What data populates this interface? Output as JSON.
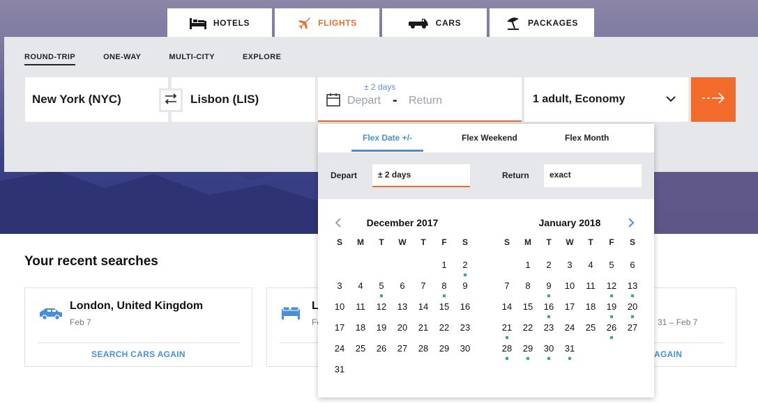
{
  "tabs": [
    {
      "label": "HOTELS",
      "icon": "bed-icon",
      "active": false
    },
    {
      "label": "FLIGHTS",
      "icon": "plane-icon",
      "active": true
    },
    {
      "label": "CARS",
      "icon": "car-icon",
      "active": false
    },
    {
      "label": "PACKAGES",
      "icon": "beach-umbrella-icon",
      "active": false
    }
  ],
  "trip_types": [
    "ROUND-TRIP",
    "ONE-WAY",
    "MULTI-CITY",
    "EXPLORE"
  ],
  "search": {
    "origin": "New York (NYC)",
    "destination": "Lisbon (LIS)",
    "flex_hint": "± 2 days",
    "depart_placeholder": "Depart",
    "date_separator": "-",
    "return_placeholder": "Return",
    "travelers": "1 adult, Economy"
  },
  "flex_popup": {
    "tabs": [
      "Flex Date +/-",
      "Flex Weekend",
      "Flex Month"
    ],
    "depart_label": "Depart",
    "depart_value": "± 2 days",
    "return_label": "Return",
    "return_value": "exact"
  },
  "calendar": {
    "weekdays": [
      "S",
      "M",
      "T",
      "W",
      "T",
      "F",
      "S"
    ],
    "months": [
      {
        "title": "December 2017",
        "first_weekday": 5,
        "days": 31,
        "marked": [
          2,
          5,
          8
        ]
      },
      {
        "title": "January 2018",
        "first_weekday": 1,
        "days": 31,
        "marked": [
          9,
          12,
          13,
          16,
          19,
          20,
          21,
          26,
          28,
          29,
          30,
          31
        ]
      }
    ]
  },
  "recent": {
    "title": "Your recent searches",
    "cards": [
      {
        "title": "London, United Kingdom",
        "date": "Feb 7",
        "action": "SEARCH CARS AGAIN",
        "icon": "car-icon"
      },
      {
        "title": "L",
        "date": "Fe",
        "date_right": "31 – Feb 7",
        "action": "AGAIN",
        "icon": "bed-icon"
      }
    ]
  },
  "colors": {
    "accent": "#f26b2a",
    "link": "#4a8fd6",
    "marker": "#2bb673",
    "panel": "#e6e7eb"
  }
}
